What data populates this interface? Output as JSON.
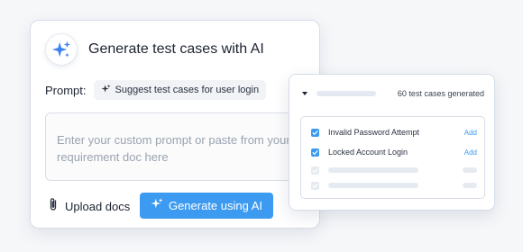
{
  "main_card": {
    "title": "Generate test cases with AI",
    "prompt_label": "Prompt:",
    "suggestion_chip": "Suggest test cases for user login",
    "prompt_placeholder": "Enter your custom prompt or paste from your requirement doc here",
    "upload_label": "Upload docs",
    "generate_label": "Generate using AI",
    "icons": {
      "badge": "sparkle-icon",
      "chip": "sparkle-icon",
      "upload": "paperclip-icon",
      "generate": "sparkle-icon"
    }
  },
  "results_card": {
    "count_text": "60 test cases generated",
    "add_label": "Add",
    "items": [
      {
        "label": "Invalid Password Attempt",
        "checked": true
      },
      {
        "label": "Locked Account Login",
        "checked": true
      }
    ]
  },
  "colors": {
    "accent": "#3c9bf0",
    "text": "#1c2330",
    "placeholder": "#9aa3b0",
    "border": "#d5dde8"
  }
}
